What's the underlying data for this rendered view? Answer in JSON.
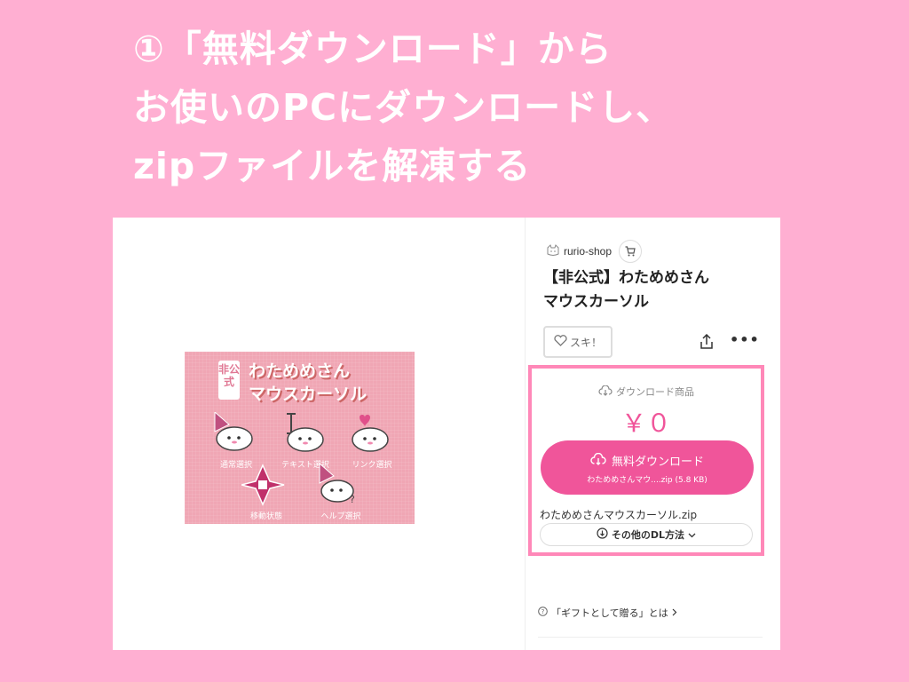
{
  "instruction": {
    "line1": "①「無料ダウンロード」から",
    "line2": "お使いのPCにダウンロードし、",
    "line3": "zipファイルを解凍する"
  },
  "product_image": {
    "badge": "非公式",
    "title_line1": "わためめさん",
    "title_line2": "マウスカーソル",
    "cursors": [
      "通常選択",
      "テキスト選択",
      "リンク選択",
      "移動状態",
      "ヘルプ選択"
    ]
  },
  "shop": {
    "name": "rurio-shop"
  },
  "product": {
    "title_line1": "【非公式】わためめさん",
    "title_line2": "マウスカーソル"
  },
  "actions": {
    "like_label": "スキ！"
  },
  "download": {
    "type_label": "ダウンロード商品",
    "price": "￥０",
    "button_label": "無料ダウンロード",
    "button_sub": "わためめさんマウ....zip (5.8 KB)",
    "filename": "わためめさんマウスカーソル.zip",
    "other_methods": "その他のDL方法"
  },
  "gift": {
    "label": "「ギフトとして贈る」とは"
  },
  "colors": {
    "background": "#ffafd2",
    "accent": "#f0559a",
    "highlight_border": "#ff88b8",
    "image_bg": "#f0a6b4"
  }
}
